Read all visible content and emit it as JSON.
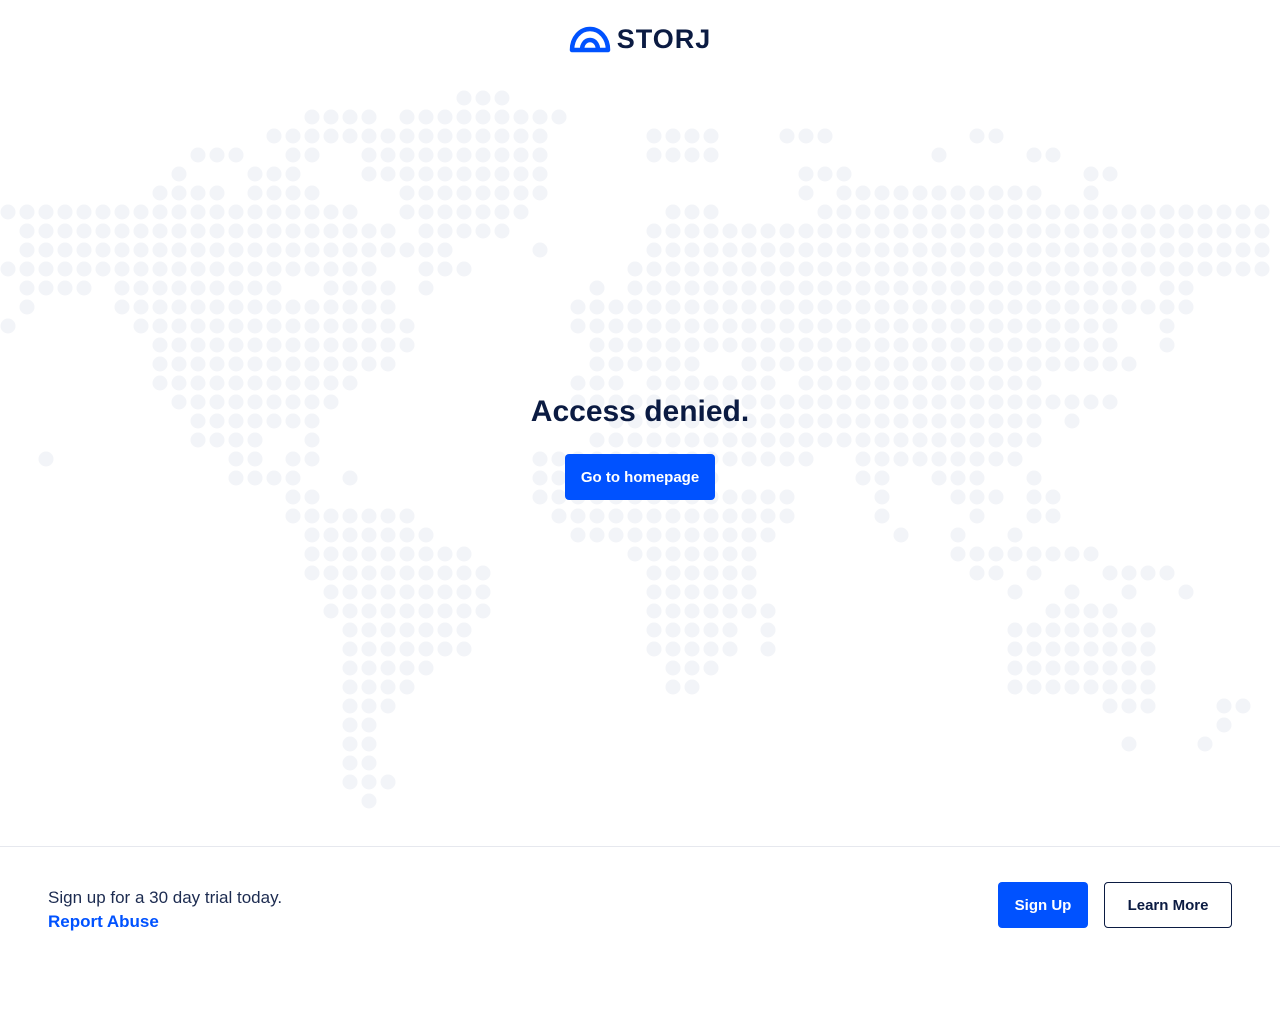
{
  "brand": {
    "name": "STORJ",
    "logo_icon": "storj-cloud-icon",
    "primary_color": "#0052ff",
    "text_color": "#0b1b42"
  },
  "main": {
    "title": "Access denied.",
    "homepage_button": "Go to homepage",
    "background": "world-map-dots"
  },
  "footer": {
    "tagline": "Sign up for a 30 day trial today.",
    "report_link": "Report Abuse",
    "signup_button": "Sign Up",
    "learn_more_button": "Learn More"
  }
}
